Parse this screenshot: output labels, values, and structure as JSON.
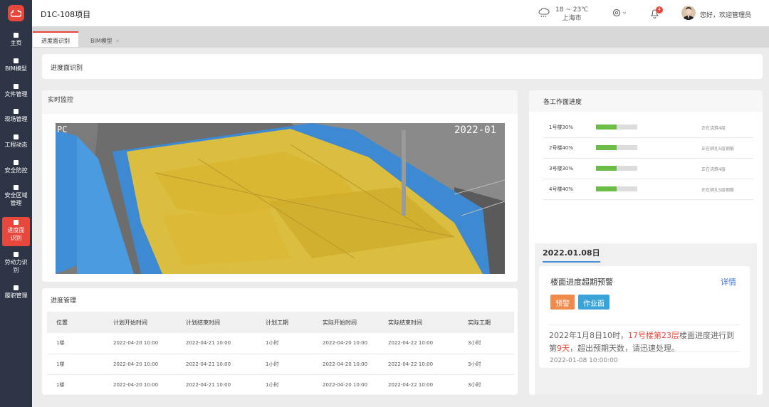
{
  "header": {
    "project_title": "D1C-108项目",
    "weather_temp": "18 ~ 23℃",
    "weather_city": "上海市",
    "notification_count": "4",
    "greeting": "您好，欢迎管理员"
  },
  "sidebar": {
    "items": [
      {
        "label": "主页"
      },
      {
        "label": "BIM模型"
      },
      {
        "label": "文件管理"
      },
      {
        "label": "现场管理"
      },
      {
        "label": "工程动态"
      },
      {
        "label": "安全防控"
      },
      {
        "label": "安全区域管理"
      },
      {
        "label": "进度面识别"
      },
      {
        "label": "劳动力识别"
      },
      {
        "label": "履职管理"
      }
    ]
  },
  "tabs": [
    {
      "label": "进度面识别"
    },
    {
      "label": "BIM模型"
    }
  ],
  "page_title": "进度面识别",
  "monitor": {
    "title": "实时监控",
    "overlay_left": "PC",
    "overlay_right": "2022-01"
  },
  "progress_table": {
    "title": "进度管理",
    "columns": [
      "位置",
      "计划开始时间",
      "计划结束时间",
      "计划工期",
      "实际开始时间",
      "实际结束时间",
      "实际工期"
    ],
    "rows": [
      [
        "1楼",
        "2022-04-20 10:00",
        "2022-04-21 10:00",
        "1小时",
        "2022-04-20 10:00",
        "2022-04-22 10:00",
        "3小时"
      ],
      [
        "1楼",
        "2022-04-20 10:00",
        "2022-04-21 10:00",
        "1小时",
        "2022-04-20 10:00",
        "2022-04-22 10:00",
        "3小时"
      ],
      [
        "1楼",
        "2022-04-20 10:00",
        "2022-04-21 10:00",
        "1小时",
        "2022-04-20 10:00",
        "2022-04-22 10:00",
        "3小时"
      ]
    ]
  },
  "work_progress": {
    "title": "各工作面进度",
    "items": [
      {
        "label": "1号楼30%",
        "progress": 0.5,
        "status": "正在浇筑4层"
      },
      {
        "label": "2号楼40%",
        "progress": 0.5,
        "status": "正在绑扎5层钢筋"
      },
      {
        "label": "3号楼30%",
        "progress": 0.5,
        "status": "正在浇筑4层"
      },
      {
        "label": "4号楼40%",
        "progress": 0.5,
        "status": "正在绑扎5层钢筋"
      }
    ]
  },
  "alert": {
    "date": "2022.01.08日",
    "title": "楼面进度超期预警",
    "detail_link": "详情",
    "tag_warning": "预警",
    "tag_area": "作业面",
    "msg_pre": "2022年1月8日10时，",
    "msg_red1": "17号楼第23层",
    "msg_mid": "楼面进度进行到第",
    "msg_red2": "9天",
    "msg_post": "，超出预期天数，请迅速处理。",
    "time": "2022-01-08  10:00:00"
  },
  "colors": {
    "accent": "#e8473b",
    "sidebar_bg": "#2e3546",
    "progress_green": "#6cbd45",
    "tag_orange": "#f08a4b",
    "tag_blue": "#3aa3d8",
    "link_blue": "#3b73d9",
    "overlay_yellow": "#e8c233"
  }
}
